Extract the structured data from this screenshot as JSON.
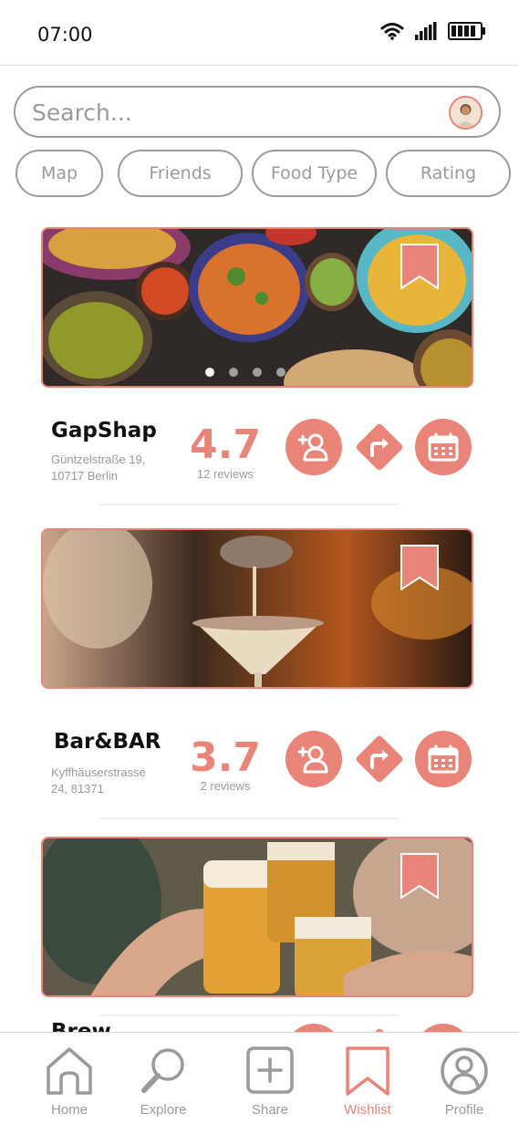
{
  "status_bar": {
    "time": "07:00"
  },
  "search": {
    "placeholder": "Search..."
  },
  "filters": [
    "Map",
    "Friends",
    "Food Type",
    "Rating"
  ],
  "places": [
    {
      "name": "GapShap",
      "address_line1": "Güntzelstraße 19,",
      "address_line2": "10717 Berlin",
      "rating": "4.7",
      "reviews": "12 reviews"
    },
    {
      "name": "Bar&BAR",
      "address_line1": "Kyffhäuserstrasse",
      "address_line2": "24, 81371",
      "rating": "3.7",
      "reviews": "2 reviews"
    },
    {
      "name": "Brew",
      "address_line1": "",
      "address_line2": "",
      "rating": "",
      "reviews": ""
    }
  ],
  "nav": {
    "items": [
      {
        "label": "Home",
        "icon": "home-icon"
      },
      {
        "label": "Explore",
        "icon": "magnifier-icon"
      },
      {
        "label": "Share",
        "icon": "plus-square-icon"
      },
      {
        "label": "Wishlist",
        "icon": "bookmark-icon"
      },
      {
        "label": "Profile",
        "icon": "user-circle-icon"
      }
    ],
    "active": "Wishlist"
  },
  "colors": {
    "accent": "#e88478",
    "muted": "#9a9a9a"
  }
}
